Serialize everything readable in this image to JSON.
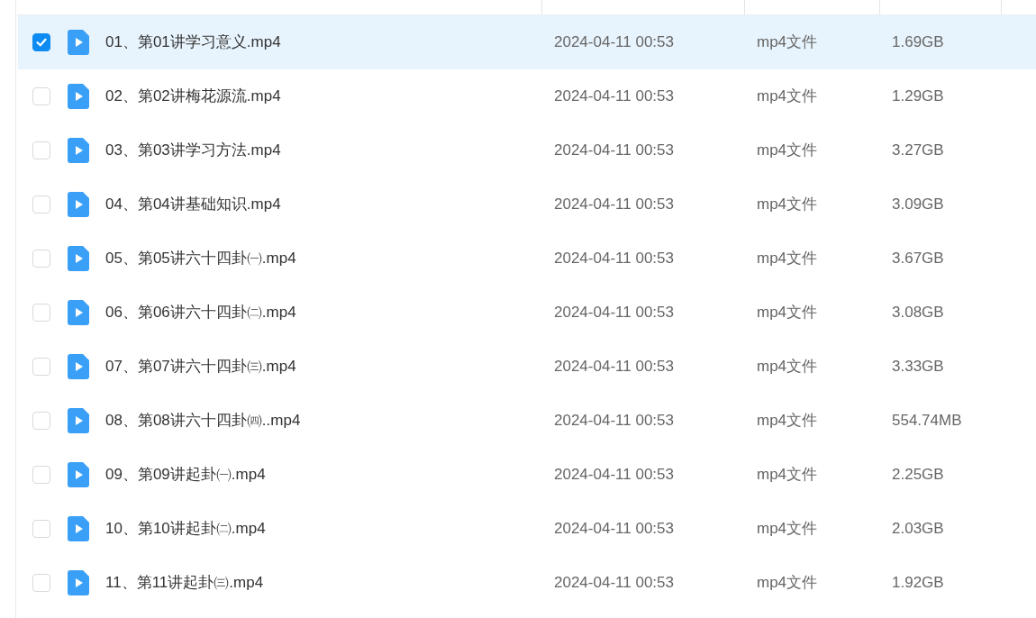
{
  "files": [
    {
      "name": "01、第01讲学习意义.mp4",
      "modified": "2024-04-11 00:53",
      "type": "mp4文件",
      "size": "1.69GB",
      "selected": true
    },
    {
      "name": "02、第02讲梅花源流.mp4",
      "modified": "2024-04-11 00:53",
      "type": "mp4文件",
      "size": "1.29GB",
      "selected": false
    },
    {
      "name": "03、第03讲学习方法.mp4",
      "modified": "2024-04-11 00:53",
      "type": "mp4文件",
      "size": "3.27GB",
      "selected": false
    },
    {
      "name": "04、第04讲基础知识.mp4",
      "modified": "2024-04-11 00:53",
      "type": "mp4文件",
      "size": "3.09GB",
      "selected": false
    },
    {
      "name": "05、第05讲六十四卦㈠.mp4",
      "modified": "2024-04-11 00:53",
      "type": "mp4文件",
      "size": "3.67GB",
      "selected": false
    },
    {
      "name": "06、第06讲六十四卦㈡.mp4",
      "modified": "2024-04-11 00:53",
      "type": "mp4文件",
      "size": "3.08GB",
      "selected": false
    },
    {
      "name": "07、第07讲六十四卦㈢.mp4",
      "modified": "2024-04-11 00:53",
      "type": "mp4文件",
      "size": "3.33GB",
      "selected": false
    },
    {
      "name": "08、第08讲六十四卦㈣..mp4",
      "modified": "2024-04-11 00:53",
      "type": "mp4文件",
      "size": "554.74MB",
      "selected": false
    },
    {
      "name": "09、第09讲起卦㈠.mp4",
      "modified": "2024-04-11 00:53",
      "type": "mp4文件",
      "size": "2.25GB",
      "selected": false
    },
    {
      "name": "10、第10讲起卦㈡.mp4",
      "modified": "2024-04-11 00:53",
      "type": "mp4文件",
      "size": "2.03GB",
      "selected": false
    },
    {
      "name": "11、第11讲起卦㈢.mp4",
      "modified": "2024-04-11 00:53",
      "type": "mp4文件",
      "size": "1.92GB",
      "selected": false
    }
  ]
}
